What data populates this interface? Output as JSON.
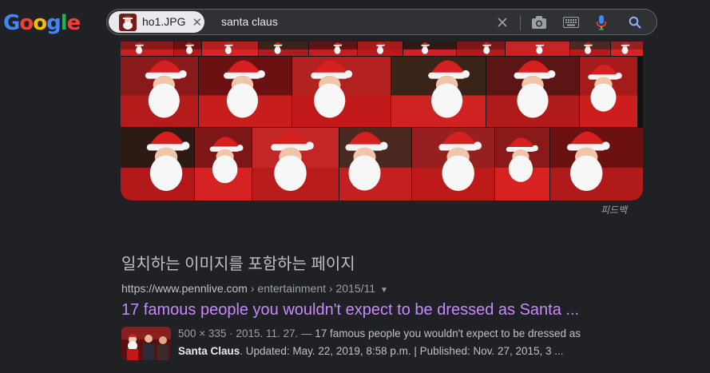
{
  "logo": {
    "letters": [
      "G",
      "o",
      "o",
      "g",
      "l",
      "e"
    ]
  },
  "search": {
    "image_chip_name": "ho1.JPG",
    "image_chip_close": "✕",
    "query": "santa claus"
  },
  "colors": {
    "background": "#202124",
    "link_visited": "#c58af9",
    "text_secondary": "#9aa0a6",
    "searchbox_bg": "#303134"
  },
  "icons": [
    "clear-icon",
    "camera-icon",
    "keyboard-icon",
    "microphone-icon",
    "search-icon"
  ],
  "image_results": {
    "feedback_label": "피드백",
    "row_count": 3
  },
  "pages_section": {
    "title": "일치하는 이미지를 포함하는 페이지",
    "result": {
      "url_host": "https://www.pennlive.com",
      "url_path": " › entertainment › 2015/11",
      "title": "17 famous people you wouldn't expect to be dressed as Santa ...",
      "meta": "500 × 335 · 2015. 11. 27. — ",
      "snippet_line1": "17 famous people you wouldn't expect to be dressed as",
      "snippet_bold": "Santa Claus",
      "snippet_line2_rest": ". Updated: May. 22, 2019, 8:58 p.m. | Published: Nov. 27, 2015, 3 ..."
    }
  }
}
